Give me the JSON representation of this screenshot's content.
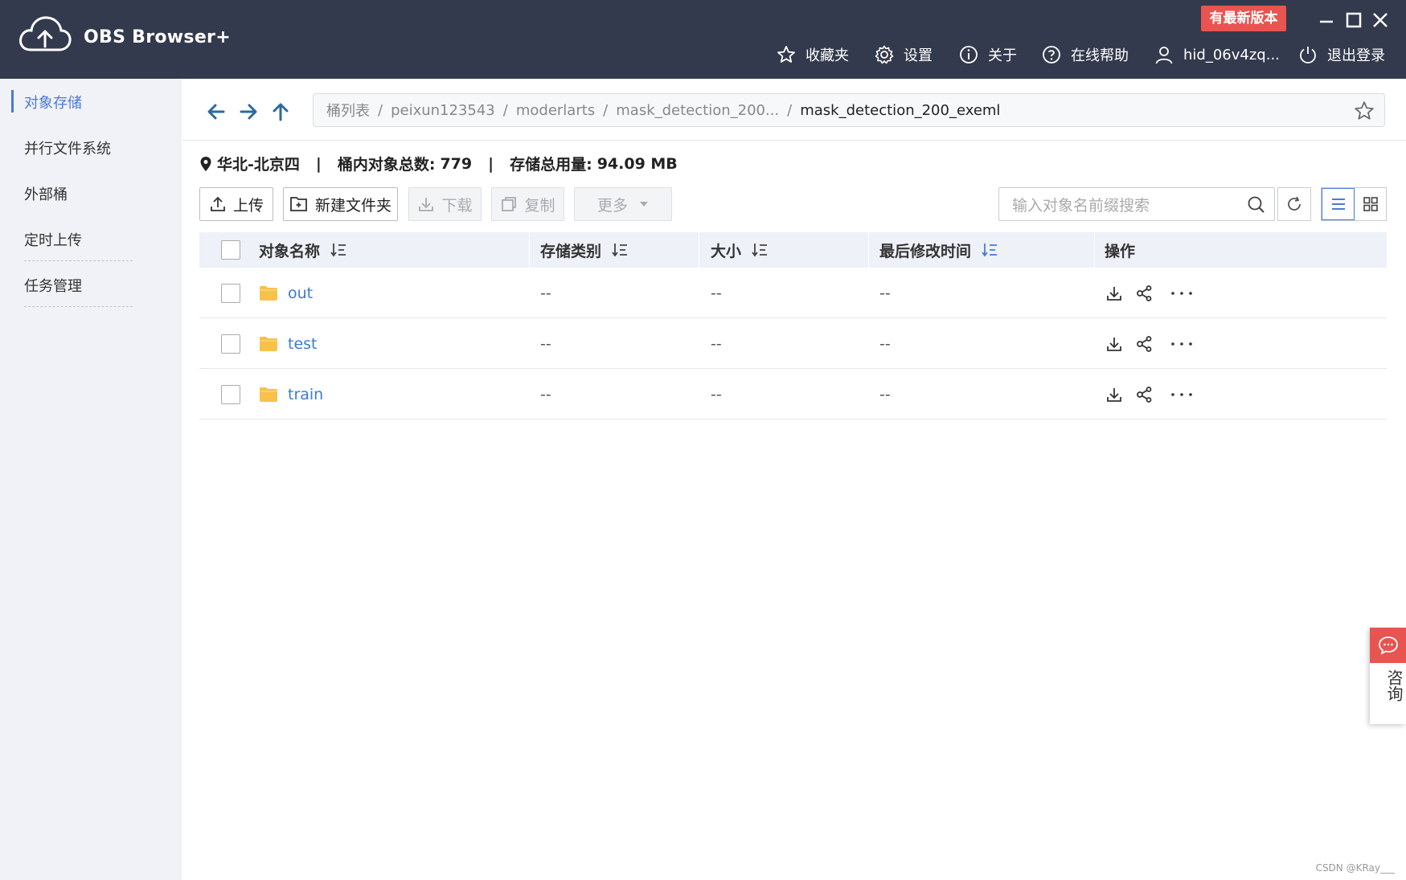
{
  "header": {
    "app_title": "OBS Browser+",
    "new_version_badge": "有最新版本",
    "nav": {
      "favorites": "收藏夹",
      "settings": "设置",
      "about": "关于",
      "help": "在线帮助",
      "user": "hid_06v4zq...",
      "logout": "退出登录"
    }
  },
  "sidebar": {
    "items": [
      {
        "label": "对象存储"
      },
      {
        "label": "并行文件系统"
      },
      {
        "label": "外部桶"
      },
      {
        "label": "定时上传"
      },
      {
        "label": "任务管理"
      }
    ]
  },
  "breadcrumb": {
    "items": [
      "桶列表",
      "peixun123543",
      "moderlarts",
      "mask_detection_200..."
    ],
    "current": "mask_detection_200_exeml"
  },
  "bucket_info": {
    "region": "华北-北京四",
    "object_count_label": "桶内对象总数:",
    "object_count": "779",
    "storage_label": "存储总用量:",
    "storage_value": "94.09 MB"
  },
  "toolbar": {
    "upload": "上传",
    "new_folder": "新建文件夹",
    "download": "下载",
    "copy": "复制",
    "more": "更多"
  },
  "search": {
    "placeholder": "输入对象名前缀搜索"
  },
  "table": {
    "columns": [
      "对象名称",
      "存储类别",
      "大小",
      "最后修改时间",
      "操作"
    ],
    "rows": [
      {
        "name": "out",
        "storage_class": "--",
        "size": "--",
        "modified": "--"
      },
      {
        "name": "test",
        "storage_class": "--",
        "size": "--",
        "modified": "--"
      },
      {
        "name": "train",
        "storage_class": "--",
        "size": "--",
        "modified": "--"
      }
    ]
  },
  "consult": {
    "label": "咨询"
  },
  "watermark": "CSDN @KRay___",
  "colors": {
    "header_bg": "#343a4d",
    "accent": "#4a79d9",
    "link": "#3a7bd5",
    "badge": "#e8544f",
    "folder": "#f7c14a"
  }
}
